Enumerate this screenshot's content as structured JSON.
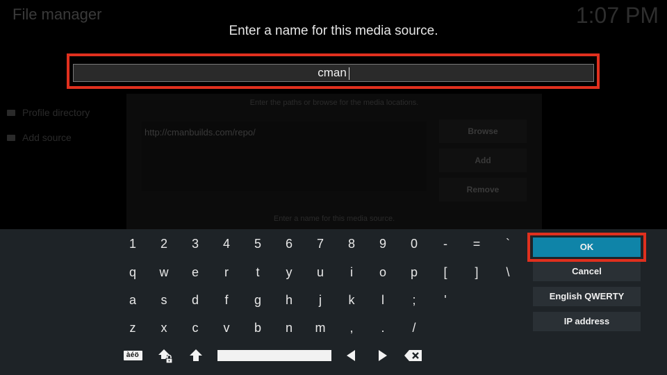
{
  "app": {
    "title": "File manager",
    "clock": "1:07 PM"
  },
  "sidebar": {
    "items": [
      {
        "label": "Profile directory"
      },
      {
        "label": "Add source"
      }
    ]
  },
  "background_dialog": {
    "paths_hint": "Enter the paths or browse for the media locations.",
    "url": "http://cmanbuilds.com/repo/",
    "browse_label": "Browse",
    "add_label": "Add",
    "remove_label": "Remove",
    "name_hint": "Enter a name for this media source."
  },
  "dialog": {
    "heading": "Enter a name for this media source.",
    "input_value": "cman"
  },
  "keyboard": {
    "rows": [
      [
        "1",
        "2",
        "3",
        "4",
        "5",
        "6",
        "7",
        "8",
        "9",
        "0",
        "-",
        "=",
        "`"
      ],
      [
        "q",
        "w",
        "e",
        "r",
        "t",
        "y",
        "u",
        "i",
        "o",
        "p",
        "[",
        "]",
        "\\"
      ],
      [
        "a",
        "s",
        "d",
        "f",
        "g",
        "h",
        "j",
        "k",
        "l",
        ";",
        "'"
      ],
      [
        "z",
        "x",
        "c",
        "v",
        "b",
        "n",
        "m",
        ",",
        ".",
        "/"
      ]
    ],
    "accent_label": "àéö",
    "ok_label": "OK",
    "cancel_label": "Cancel",
    "layout_label": "English QWERTY",
    "ip_label": "IP address"
  },
  "icons": [
    "shift-lock-icon",
    "shift-icon",
    "arrow-left-icon",
    "arrow-right-icon",
    "backspace-icon",
    "folder-icon"
  ],
  "colors": {
    "highlight": "#e0301e",
    "ok_button": "#0f84a8",
    "keyboard_bg": "#1e2327"
  }
}
